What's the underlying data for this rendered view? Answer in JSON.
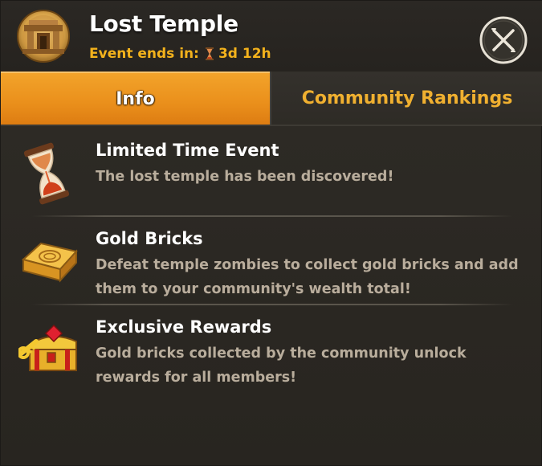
{
  "header": {
    "title": "Lost Temple",
    "event_ends_label": "Event ends in:",
    "event_ends_value": "3d 12h",
    "event_icon": "temple-ruins-icon",
    "close_icon": "close-icon"
  },
  "tabs": [
    {
      "label": "Info",
      "active": true
    },
    {
      "label": "Community Rankings",
      "active": false
    }
  ],
  "items": [
    {
      "icon": "hourglass-icon",
      "title": "Limited Time Event",
      "description": "The lost temple has been discovered!"
    },
    {
      "icon": "gold-brick-icon",
      "title": "Gold Bricks",
      "description": "Defeat temple zombies to collect gold bricks and add them to your community's wealth total!"
    },
    {
      "icon": "treasure-chest-key-icon",
      "title": "Exclusive Rewards",
      "description": "Gold bricks collected by the community unlock rewards for all members!"
    }
  ],
  "colors": {
    "accent_orange": "#ea8f1b",
    "gold_text": "#f3b21c",
    "panel_bg": "#2b2824",
    "desc_text": "#b9ad9c"
  }
}
